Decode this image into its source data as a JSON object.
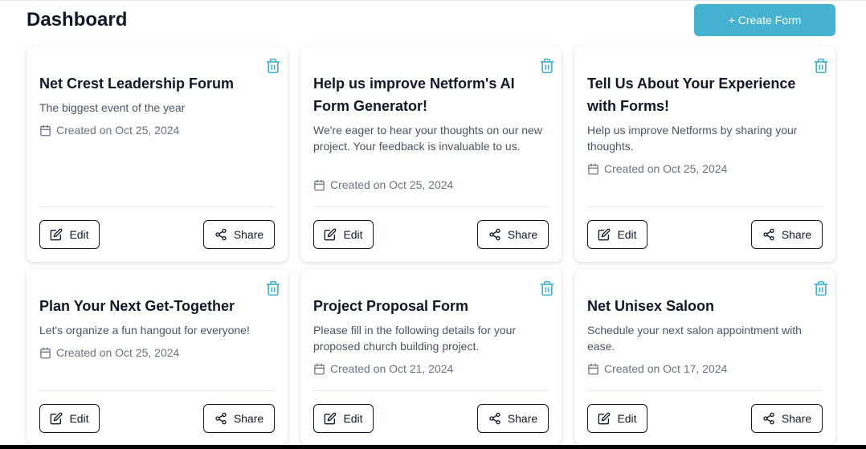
{
  "header": {
    "title": "Dashboard",
    "create_button": "+ Create Form"
  },
  "forms": [
    {
      "title": "Net Crest Leadership Forum",
      "description": "The biggest event of the year",
      "created": "Created on Oct 25, 2024",
      "edit_label": "Edit",
      "share_label": "Share"
    },
    {
      "title": "Help us improve Netform's AI Form Generator!",
      "description": "We're eager to hear your thoughts on our new project. Your feedback is invaluable to us.",
      "created": "Created on Oct 25, 2024",
      "edit_label": "Edit",
      "share_label": "Share"
    },
    {
      "title": "Tell Us About Your Experience with Forms!",
      "description": "Help us improve Netforms by sharing your thoughts.",
      "created": "Created on Oct 25, 2024",
      "edit_label": "Edit",
      "share_label": "Share"
    },
    {
      "title": "Plan Your Next Get-Together",
      "description": "Let's organize a fun hangout for everyone!",
      "created": "Created on Oct 25, 2024",
      "edit_label": "Edit",
      "share_label": "Share"
    },
    {
      "title": "Project Proposal Form",
      "description": "Please fill in the following details for your proposed church building project.",
      "created": "Created on Oct 21, 2024",
      "edit_label": "Edit",
      "share_label": "Share"
    },
    {
      "title": "Net Unisex Saloon",
      "description": "Schedule your next salon appointment with ease.",
      "created": "Created on Oct 17, 2024",
      "edit_label": "Edit",
      "share_label": "Share"
    }
  ],
  "colors": {
    "accent": "#45b3cf",
    "trash_icon": "#45b3cf"
  },
  "icons": {
    "delete": "trash-icon",
    "date": "calendar-icon",
    "edit": "edit-icon",
    "share": "share-icon"
  }
}
